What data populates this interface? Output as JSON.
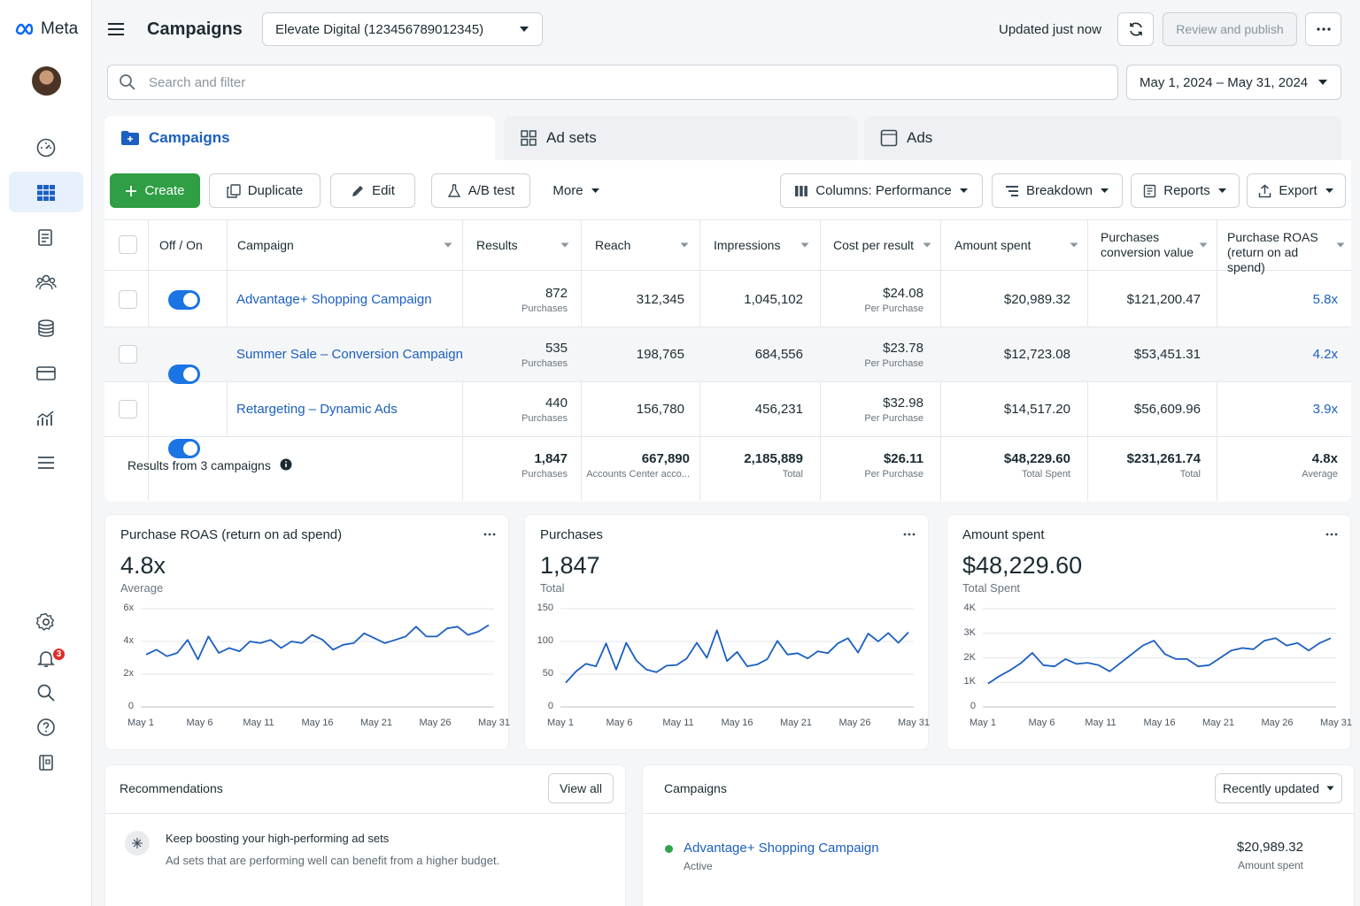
{
  "brand": {
    "name": "Meta"
  },
  "header": {
    "title": "Campaigns",
    "account": "Elevate Digital (123456789012345)",
    "updated": "Updated just now",
    "review_publish": "Review and publish"
  },
  "search": {
    "placeholder": "Search and filter"
  },
  "date_range": "May 1, 2024 – May 31, 2024",
  "tabs": [
    {
      "label": "Campaigns"
    },
    {
      "label": "Ad sets"
    },
    {
      "label": "Ads"
    }
  ],
  "toolbar": {
    "create": "Create",
    "duplicate": "Duplicate",
    "edit": "Edit",
    "ab_test": "A/B test",
    "more": "More",
    "columns": "Columns: Performance",
    "breakdown": "Breakdown",
    "reports": "Reports",
    "export": "Export"
  },
  "notifications": {
    "count": "3"
  },
  "table": {
    "headers": {
      "toggle": "Off / On",
      "campaign": "Campaign",
      "results": "Results",
      "reach": "Reach",
      "impressions": "Impressions",
      "cpr": "Cost per result",
      "spent": "Amount spent",
      "pcv": "Purchases conversion value",
      "roas": "Purchase ROAS (return on ad spend)"
    },
    "rows": [
      {
        "name": "Advantage+ Shopping Campaign",
        "on": true,
        "results": "872",
        "results_sub": "Purchases",
        "reach": "312,345",
        "impressions": "1,045,102",
        "cpr": "$24.08",
        "cpr_sub": "Per Purchase",
        "spent": "$20,989.32",
        "pcv": "$121,200.47",
        "roas": "5.8x"
      },
      {
        "name": "Summer Sale – Conversion Campaign",
        "on": true,
        "results": "535",
        "results_sub": "Purchases",
        "reach": "198,765",
        "impressions": "684,556",
        "cpr": "$23.78",
        "cpr_sub": "Per Purchase",
        "spent": "$12,723.08",
        "pcv": "$53,451.31",
        "roas": "4.2x"
      },
      {
        "name": "Retargeting – Dynamic Ads",
        "on": true,
        "results": "440",
        "results_sub": "Purchases",
        "reach": "156,780",
        "impressions": "456,231",
        "cpr": "$32.98",
        "cpr_sub": "Per Purchase",
        "spent": "$14,517.20",
        "pcv": "$56,609.96",
        "roas": "3.9x"
      }
    ],
    "totals": {
      "label": "Results from 3 campaigns",
      "results": "1,847",
      "results_sub": "Purchases",
      "reach": "667,890",
      "reach_sub": "Accounts Center acco...",
      "impressions": "2,185,889",
      "impressions_sub": "Total",
      "cpr": "$26.11",
      "cpr_sub": "Per Purchase",
      "spent": "$48,229.60",
      "spent_sub": "Total Spent",
      "pcv": "$231,261.74",
      "pcv_sub": "Total",
      "roas": "4.8x",
      "roas_sub": "Average"
    }
  },
  "chart_data": [
    {
      "type": "line",
      "title": "Purchase ROAS (return on ad spend)",
      "value": "4.8x",
      "value_label": "Average",
      "x_tick_labels": [
        "May 1",
        "May 6",
        "May 11",
        "May 16",
        "May 21",
        "May 26",
        "May 31"
      ],
      "y_tick_labels": [
        "0",
        "2x",
        "4x",
        "6x"
      ],
      "ylim": [
        0,
        6
      ],
      "color": "#1b5fc1",
      "values": [
        3.2,
        3.5,
        3.1,
        3.3,
        4.1,
        2.9,
        4.3,
        3.3,
        3.6,
        3.4,
        4.0,
        3.9,
        4.1,
        3.6,
        4.0,
        3.9,
        4.4,
        4.1,
        3.5,
        3.8,
        3.9,
        4.5,
        4.2,
        3.9,
        4.1,
        4.3,
        4.9,
        4.3,
        4.3,
        4.8,
        4.9,
        4.4,
        4.6,
        5.0
      ]
    },
    {
      "type": "line",
      "title": "Purchases",
      "value": "1,847",
      "value_label": "Total",
      "x_tick_labels": [
        "May 1",
        "May 6",
        "May 11",
        "May 16",
        "May 21",
        "May 26",
        "May 31"
      ],
      "y_tick_labels": [
        "0",
        "50",
        "100",
        "150"
      ],
      "ylim": [
        0,
        150
      ],
      "color": "#1b5fc1",
      "values": [
        37,
        54,
        66,
        62,
        97,
        57,
        98,
        71,
        57,
        53,
        63,
        64,
        74,
        98,
        75,
        117,
        70,
        84,
        62,
        65,
        73,
        101,
        80,
        82,
        74,
        85,
        82,
        97,
        105,
        83,
        112,
        100,
        113,
        98,
        114
      ]
    },
    {
      "type": "line",
      "title": "Amount spent",
      "value": "$48,229.60",
      "value_label": "Total Spent",
      "x_tick_labels": [
        "May 1",
        "May 6",
        "May 11",
        "May 16",
        "May 21",
        "May 26",
        "May 31"
      ],
      "y_tick_labels": [
        "0",
        "1K",
        "2K",
        "3K",
        "4K"
      ],
      "ylim": [
        0,
        4000
      ],
      "color": "#1b5fc1",
      "values": [
        950,
        1250,
        1500,
        1800,
        2200,
        1700,
        1650,
        1950,
        1750,
        1800,
        1700,
        1450,
        1800,
        2150,
        2500,
        2700,
        2150,
        1950,
        1950,
        1650,
        1700,
        2000,
        2300,
        2400,
        2350,
        2700,
        2800,
        2500,
        2600,
        2300,
        2600,
        2800
      ]
    }
  ],
  "recommendations": {
    "title": "Recommendations",
    "view_all": "View all",
    "item_title": "Keep boosting your high-performing ad sets",
    "item_desc": "Ad sets that are performing well can benefit from a higher budget."
  },
  "campaigns_card": {
    "title": "Campaigns",
    "sort": "Recently updated",
    "item_name": "Advantage+ Shopping Campaign",
    "item_status": "Active",
    "item_amount": "$20,989.32",
    "item_amount_label": "Amount spent"
  }
}
